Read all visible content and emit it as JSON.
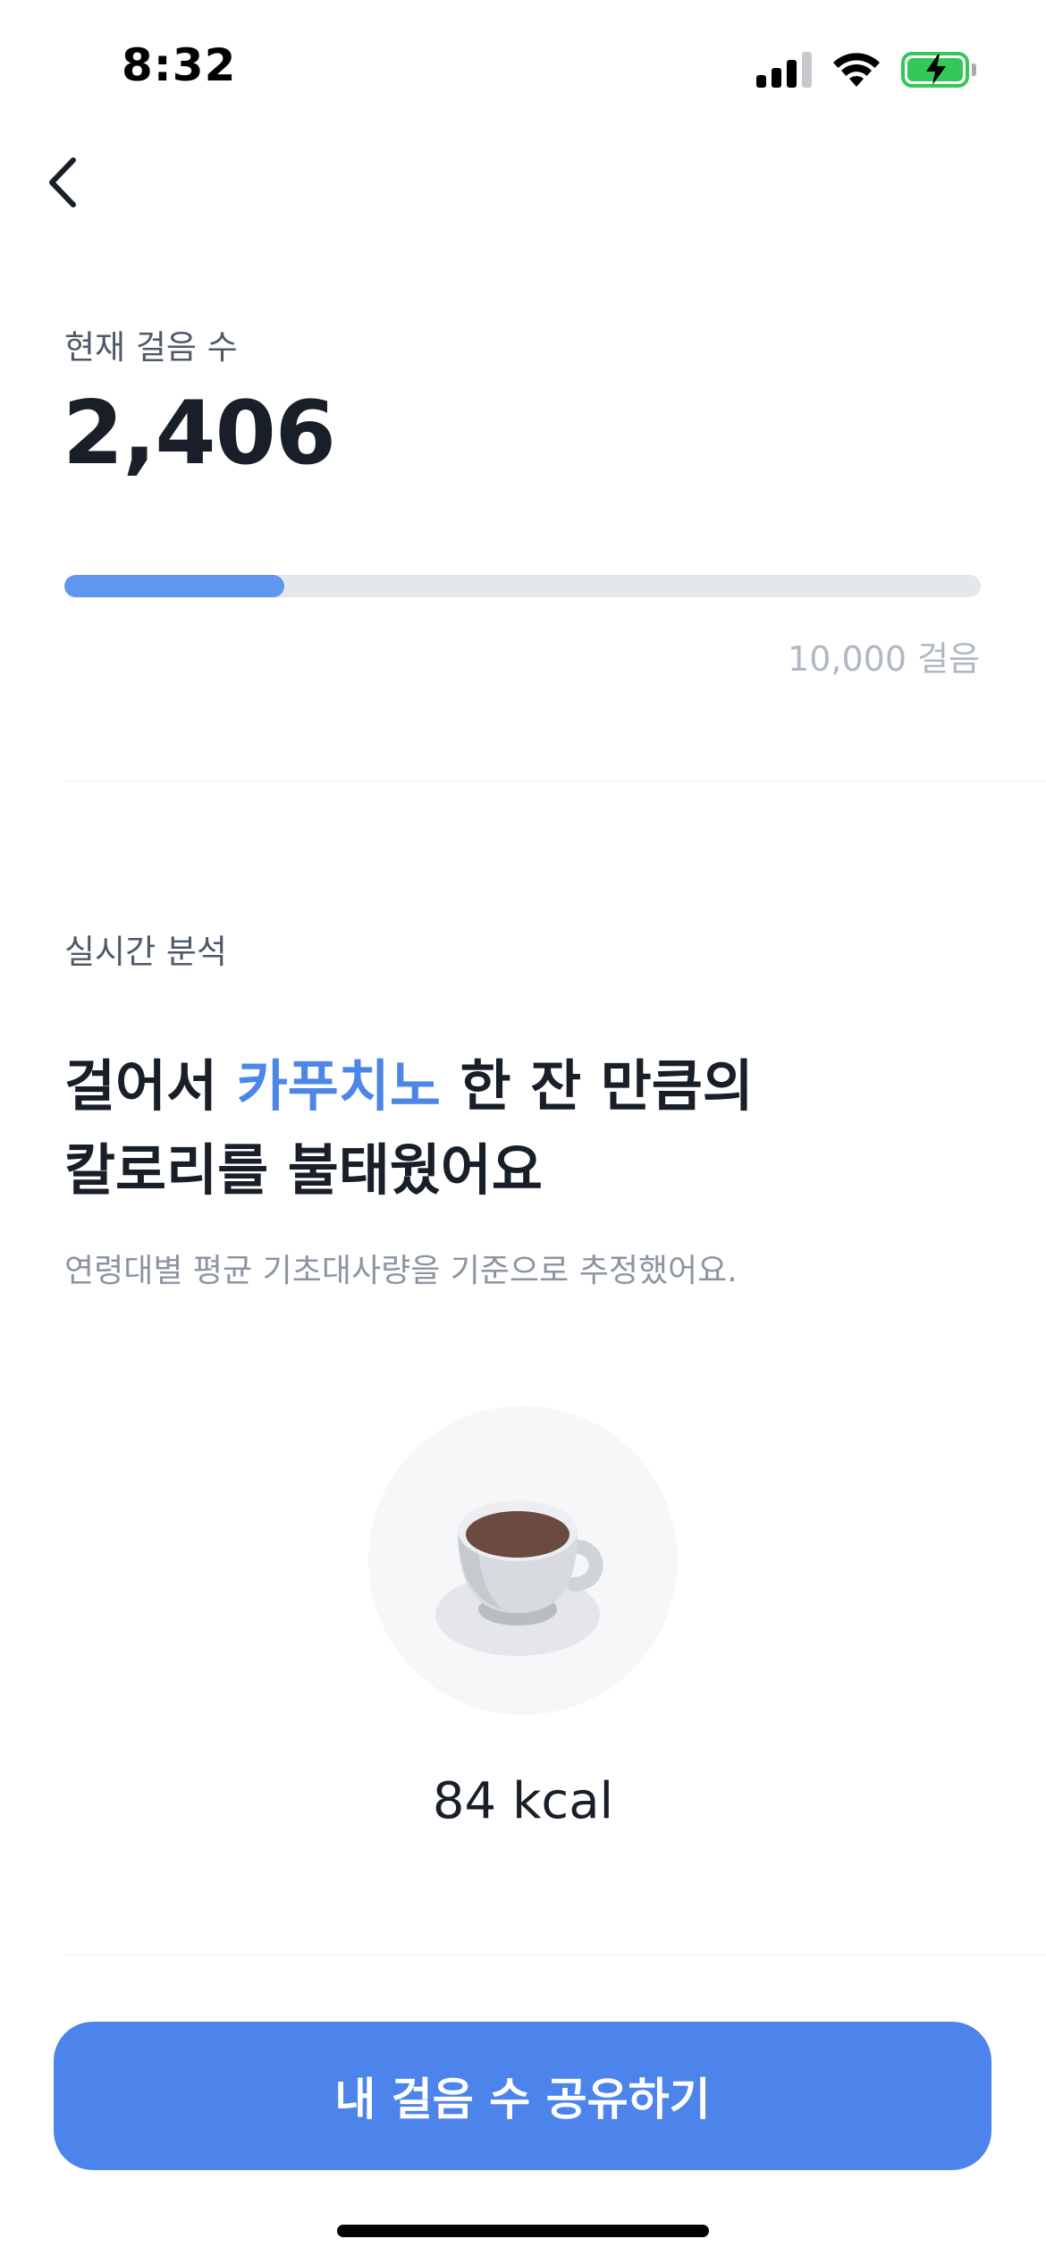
{
  "status_bar": {
    "time": "8:32",
    "icons": [
      "signal-icon",
      "wifi-icon",
      "battery-charging-icon"
    ]
  },
  "nav": {
    "back_icon": "chevron-left-icon"
  },
  "steps": {
    "label": "현재 걸음 수",
    "value": "2,406",
    "progress_percent": 24,
    "goal_label": "10,000 걸음"
  },
  "analysis": {
    "section_label": "실시간 분석",
    "headline_prefix": "걸어서 ",
    "headline_accent": "카푸치노",
    "headline_suffix_line1": " 한 잔 만큼의",
    "headline_line2": "칼로리를 불태웠어요",
    "note": "연령대별 평균 기초대사량을 기준으로 추정했어요.",
    "illustration_icon": "coffee-cup-icon",
    "kcal": "84 kcal"
  },
  "cta": {
    "share_label": "내 걸음 수 공유하기"
  },
  "colors": {
    "accent": "#4c87e8",
    "button": "#4d84ec",
    "progress": "#5f96ee",
    "battery": "#34c759"
  }
}
